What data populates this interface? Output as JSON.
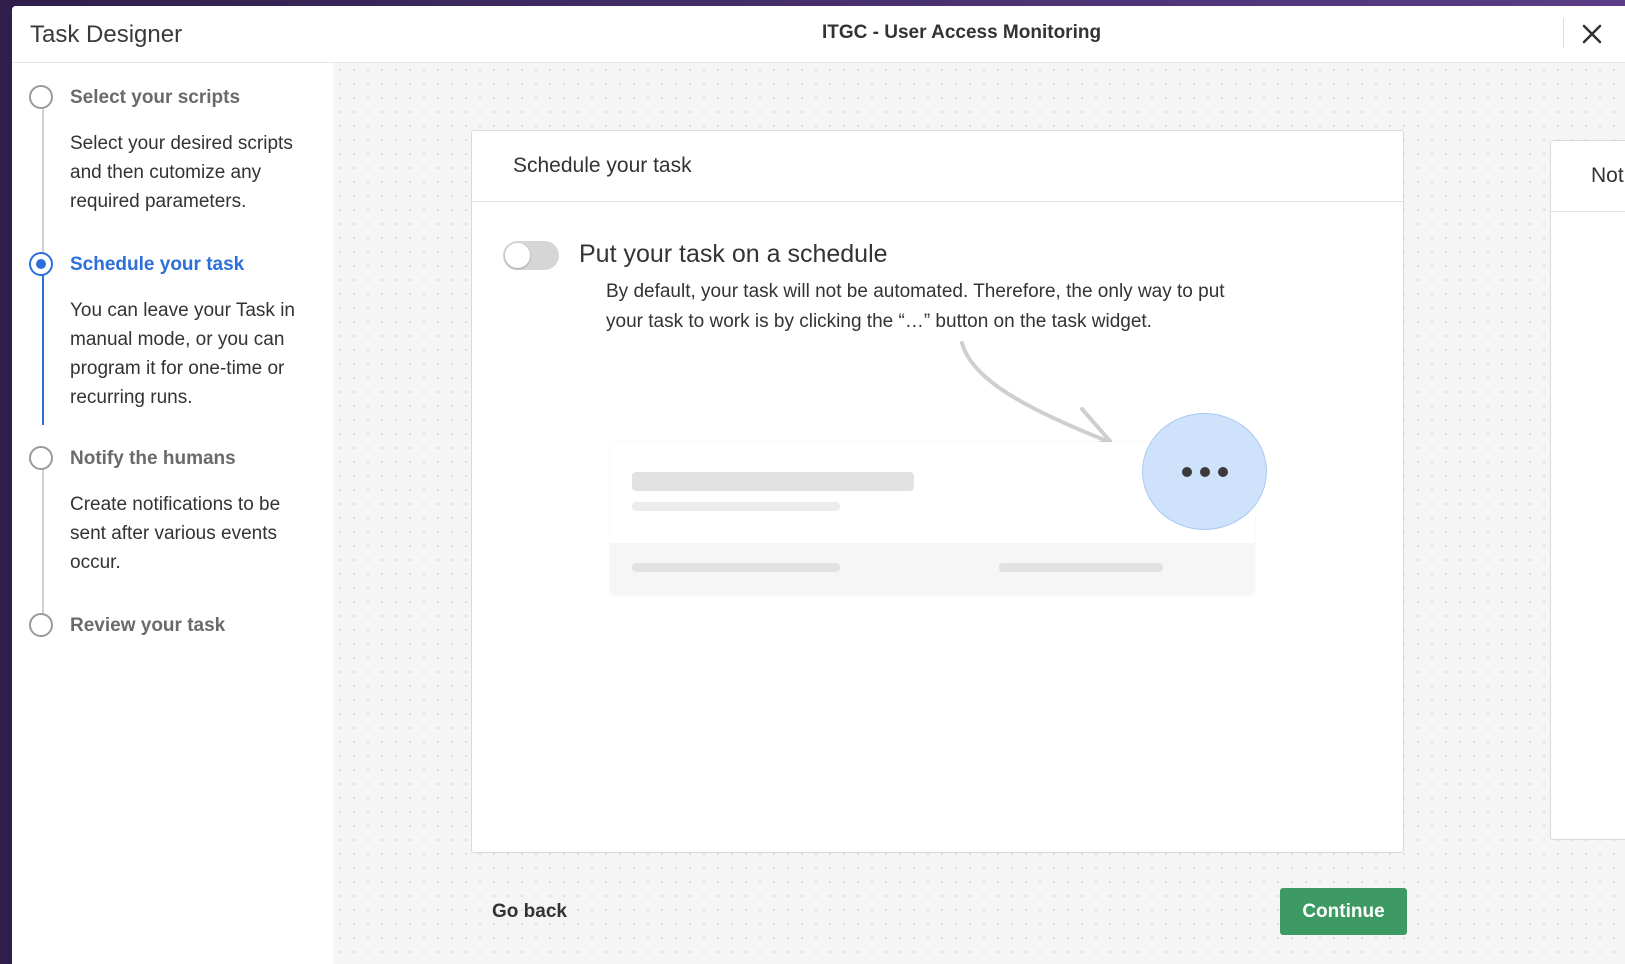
{
  "header": {
    "app_title": "Task Designer",
    "task_name": "ITGC - User Access Monitoring",
    "close_icon": "close-icon"
  },
  "sidebar": {
    "steps": [
      {
        "title": "Select your scripts",
        "description": "Select your desired scripts and then cutomize any required parameters.",
        "state": "inactive"
      },
      {
        "title": "Schedule your task",
        "description": "You can leave your Task in manual mode, or you can program it for one-time or recurring runs.",
        "state": "active"
      },
      {
        "title": "Notify the humans",
        "description": "Create notifications to be sent after various events occur.",
        "state": "inactive"
      },
      {
        "title": "Review your task",
        "description": "",
        "state": "inactive"
      }
    ]
  },
  "main": {
    "card": {
      "title": "Schedule your task",
      "toggle": {
        "label": "Put your task on a schedule",
        "checked": false,
        "description": "By default, your task will not be automated. Therefore, the only way to put your task to work is by clicking the “…” button on the task widget."
      },
      "illustration": {
        "ellipsis_icon": "ellipsis-icon",
        "arrow_icon": "curved-arrow-icon"
      }
    },
    "next_card": {
      "title": "Not"
    },
    "actions": {
      "go_back": "Go back",
      "continue": "Continue"
    }
  },
  "colors": {
    "accent": "#2a6fdb",
    "continue": "#3e9a63",
    "highlight": "#cfe2fb"
  }
}
